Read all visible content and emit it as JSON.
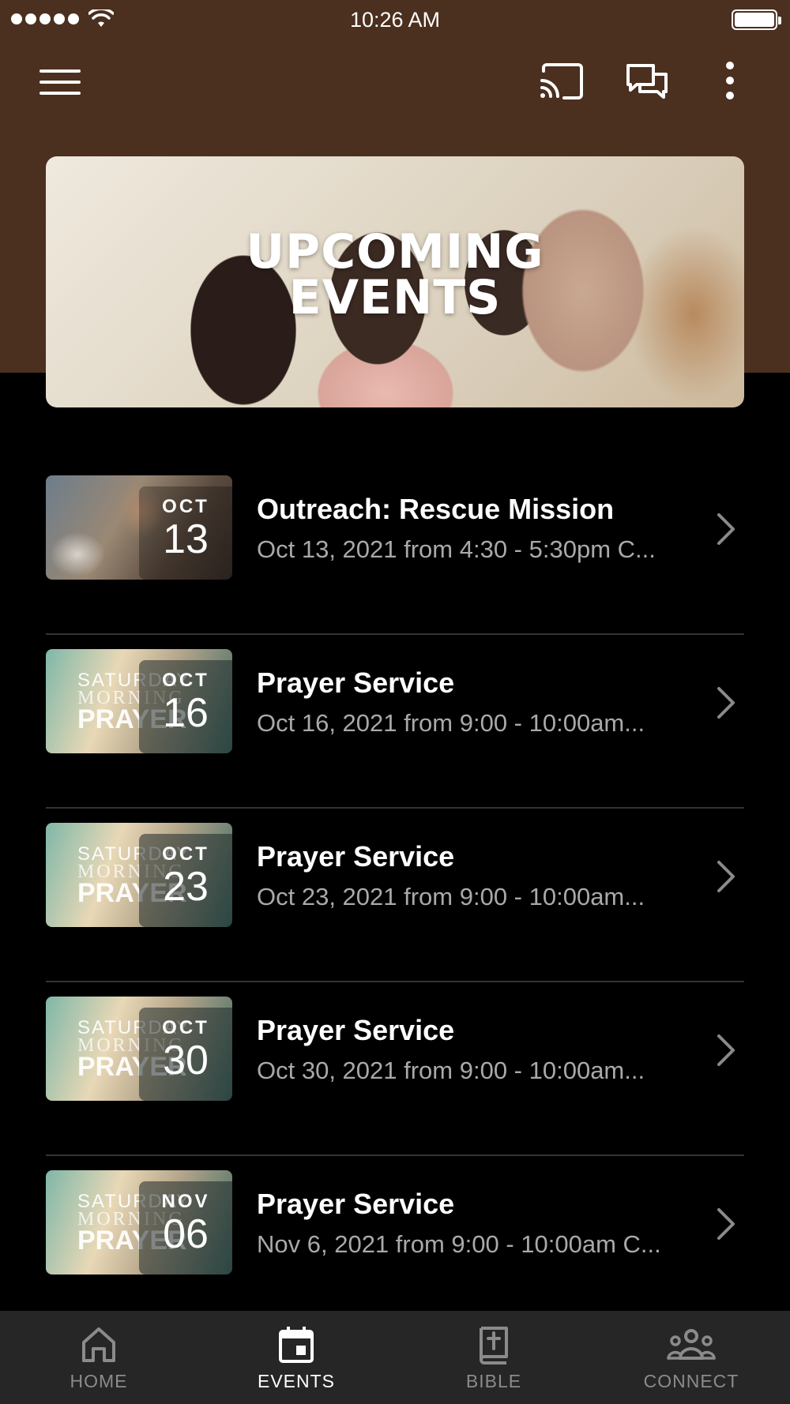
{
  "status_bar": {
    "time": "10:26 AM"
  },
  "hero": {
    "title_line1": "UPCOMING",
    "title_line2": "EVENTS"
  },
  "events": [
    {
      "title": "Outreach: Rescue Mission",
      "time": "Oct 13, 2021 from 4:30 - 5:30pm C...",
      "month": "OCT",
      "day": "13",
      "thumb": "photo"
    },
    {
      "title": "Prayer Service",
      "time": "Oct 16, 2021 from 9:00 - 10:00am...",
      "month": "OCT",
      "day": "16",
      "thumb": "prayer"
    },
    {
      "title": "Prayer Service",
      "time": "Oct 23, 2021 from 9:00 - 10:00am...",
      "month": "OCT",
      "day": "23",
      "thumb": "prayer"
    },
    {
      "title": "Prayer Service",
      "time": "Oct 30, 2021 from 9:00 - 10:00am...",
      "month": "OCT",
      "day": "30",
      "thumb": "prayer"
    },
    {
      "title": "Prayer Service",
      "time": "Nov 6, 2021 from 9:00 - 10:00am C...",
      "month": "NOV",
      "day": "06",
      "thumb": "prayer"
    }
  ],
  "prayer_art": {
    "line1": "SATURDAY",
    "line2": "MORNING",
    "line3": "PRAYER"
  },
  "tabs": [
    {
      "label": "HOME",
      "icon": "home-icon"
    },
    {
      "label": "EVENTS",
      "icon": "calendar-icon",
      "active": true
    },
    {
      "label": "BIBLE",
      "icon": "bible-icon"
    },
    {
      "label": "CONNECT",
      "icon": "people-icon"
    }
  ],
  "colors": {
    "header_brown": "#4b2f1f",
    "background": "#000000",
    "tab_bar": "#262626",
    "inactive_tab": "#8b8b8b"
  }
}
